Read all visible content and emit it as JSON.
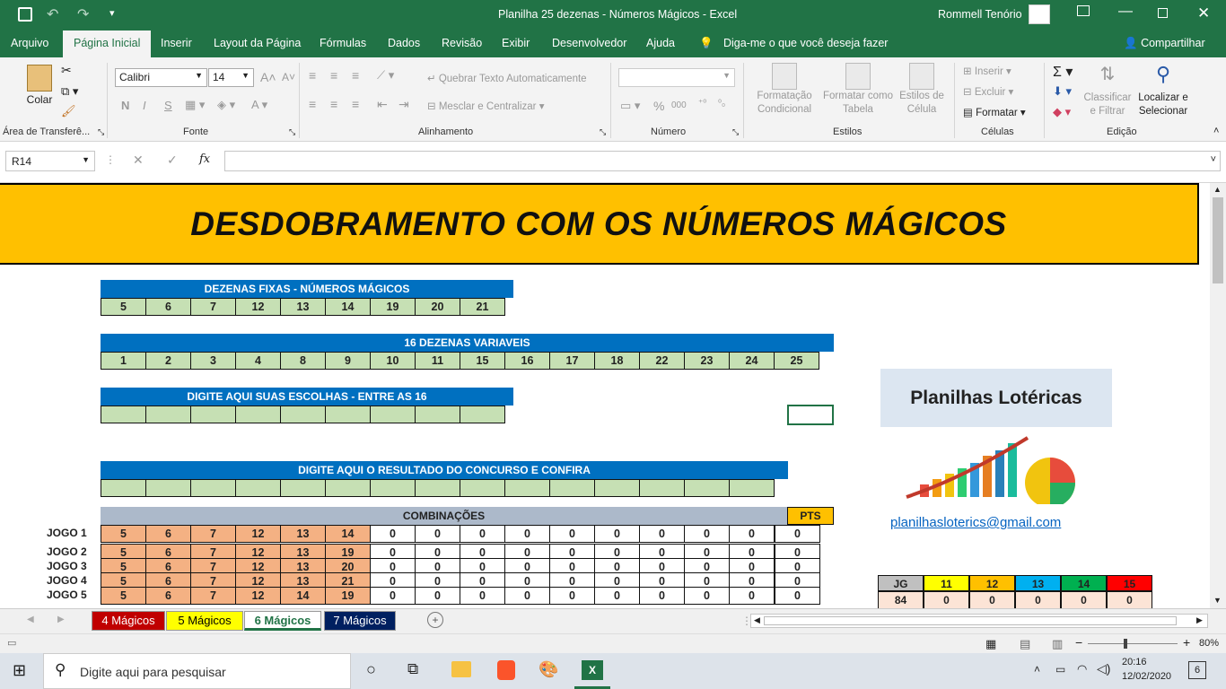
{
  "window": {
    "title": "Planilha 25 dezenas - Números Mágicos  -  Excel",
    "user": "Rommell Tenório"
  },
  "ribbon_tabs": [
    "Arquivo",
    "Página Inicial",
    "Inserir",
    "Layout da Página",
    "Fórmulas",
    "Dados",
    "Revisão",
    "Exibir",
    "Desenvolvedor",
    "Ajuda"
  ],
  "tell_me": "Diga-me o que você deseja fazer",
  "share": "Compartilhar",
  "ribbon": {
    "paste": "Colar",
    "clipboard": "Área de Transferê...",
    "font_name": "Calibri",
    "font_size": "14",
    "font_group": "Fonte",
    "bold": "N",
    "italic": "I",
    "underline": "S",
    "wrap": "Quebrar Texto Automaticamente",
    "merge": "Mesclar e Centralizar",
    "align_group": "Alinhamento",
    "number_format": "",
    "number_group": "Número",
    "percent": "%",
    "thousands": "000",
    "cond_format": "Formatação Condicional",
    "format_table": "Formatar como Tabela",
    "cell_styles": "Estilos de Célula",
    "styles_group": "Estilos",
    "insert": "Inserir",
    "delete": "Excluir",
    "format": "Formatar",
    "cells_group": "Células",
    "sort": "Classificar e Filtrar",
    "find": "Localizar e Selecionar",
    "edit_group": "Edição"
  },
  "formula_bar": {
    "name_box": "R14",
    "fx": "fx",
    "value": ""
  },
  "sheet": {
    "banner": "DESDOBRAMENTO COM OS NÚMEROS MÁGICOS",
    "fixed_header": "DEZENAS FIXAS - NÚMEROS MÁGICOS",
    "fixed": [
      "5",
      "6",
      "7",
      "12",
      "13",
      "14",
      "19",
      "20",
      "21"
    ],
    "variable_header": "16 DEZENAS VARIAVEIS",
    "variable": [
      "1",
      "2",
      "3",
      "4",
      "8",
      "9",
      "10",
      "11",
      "15",
      "16",
      "17",
      "18",
      "22",
      "23",
      "24",
      "25"
    ],
    "choose_header": "DIGITE AQUI SUAS ESCOLHAS - ENTRE AS 16",
    "result_header": "DIGITE AQUI O RESULTADO DO CONCURSO E CONFIRA",
    "comb_header": "COMBINAÇÕES",
    "pts_header": "PTS",
    "games": [
      {
        "label": "JOGO 1",
        "nums": [
          "5",
          "6",
          "7",
          "12",
          "13",
          "14"
        ],
        "zeros": [
          "0",
          "0",
          "0",
          "0",
          "0",
          "0",
          "0",
          "0",
          "0"
        ],
        "pts": "0"
      },
      {
        "label": "JOGO 2",
        "nums": [
          "5",
          "6",
          "7",
          "12",
          "13",
          "19"
        ],
        "zeros": [
          "0",
          "0",
          "0",
          "0",
          "0",
          "0",
          "0",
          "0",
          "0"
        ],
        "pts": "0"
      },
      {
        "label": "JOGO 3",
        "nums": [
          "5",
          "6",
          "7",
          "12",
          "13",
          "20"
        ],
        "zeros": [
          "0",
          "0",
          "0",
          "0",
          "0",
          "0",
          "0",
          "0",
          "0"
        ],
        "pts": "0"
      },
      {
        "label": "JOGO 4",
        "nums": [
          "5",
          "6",
          "7",
          "12",
          "13",
          "21"
        ],
        "zeros": [
          "0",
          "0",
          "0",
          "0",
          "0",
          "0",
          "0",
          "0",
          "0"
        ],
        "pts": "0"
      },
      {
        "label": "JOGO 5",
        "nums": [
          "5",
          "6",
          "7",
          "12",
          "14",
          "19"
        ],
        "zeros": [
          "0",
          "0",
          "0",
          "0",
          "0",
          "0",
          "0",
          "0",
          "0"
        ],
        "pts": "0"
      }
    ],
    "logo_title": "Planilhas Lotéricas",
    "email": "planilhasloterics@gmail.com",
    "summary": {
      "headers": [
        "JG",
        "11",
        "12",
        "13",
        "14",
        "15"
      ],
      "values": [
        "84",
        "0",
        "0",
        "0",
        "0",
        "0"
      ],
      "colors": [
        "#c0c0c0",
        "#ffff00",
        "#ffc000",
        "#00b0f0",
        "#00b050",
        "#ff0000"
      ]
    }
  },
  "sheet_tabs": [
    {
      "label": "4 Mágicos",
      "bg": "#c00000",
      "fg": "#ffffff"
    },
    {
      "label": "5 Mágicos",
      "bg": "#ffff00",
      "fg": "#000000"
    },
    {
      "label": "6 Mágicos",
      "bg": "#ffffff",
      "fg": "#217346"
    },
    {
      "label": "7 Mágicos",
      "bg": "#002060",
      "fg": "#ffffff"
    }
  ],
  "status": {
    "zoom": "80%"
  },
  "taskbar": {
    "search": "Digite aqui para pesquisar",
    "time": "20:16",
    "date": "12/02/2020",
    "notif": "6"
  }
}
